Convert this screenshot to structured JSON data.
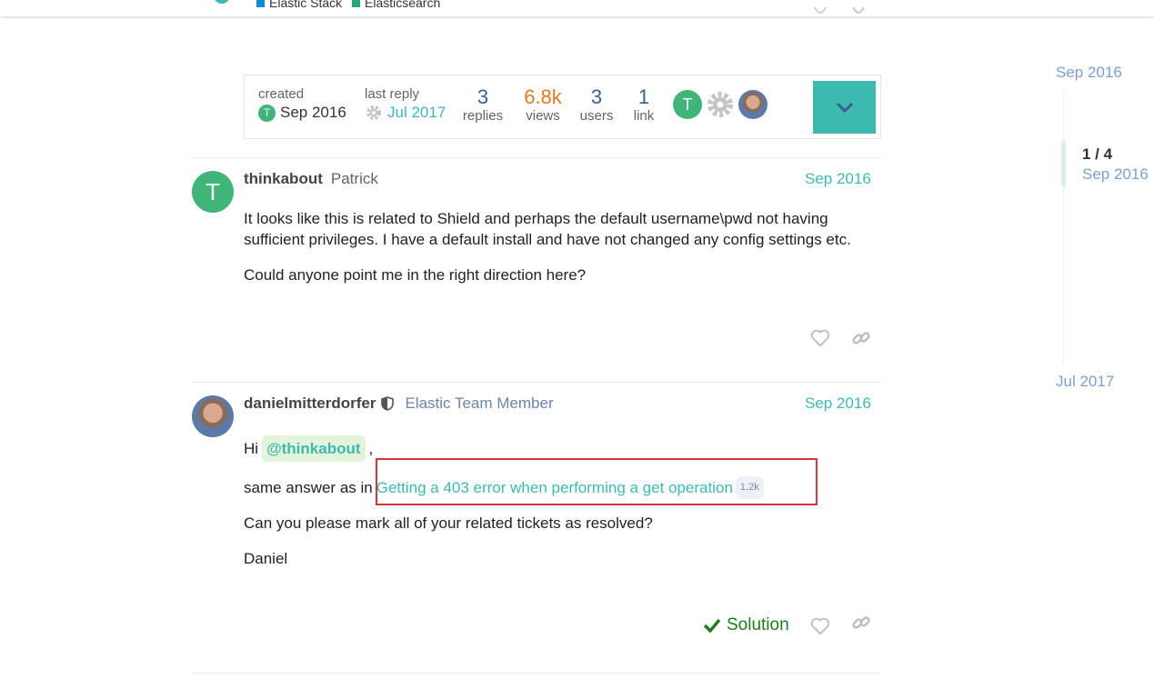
{
  "header": {
    "categories": [
      {
        "label": "Elastic Stack",
        "color": "#0a8bd6"
      },
      {
        "label": "Elasticsearch",
        "color": "#24a87a"
      }
    ]
  },
  "topic_map": {
    "created_label": "created",
    "created_value": "Sep 2016",
    "created_avatar_letter": "T",
    "last_reply_label": "last reply",
    "last_reply_value": "Jul 2017",
    "replies": {
      "value": "3",
      "label": "replies"
    },
    "views": {
      "value": "6.8k",
      "label": "views"
    },
    "users": {
      "value": "3",
      "label": "users"
    },
    "links": {
      "value": "1",
      "label": "link"
    },
    "participant_letter": "T",
    "expand_icon": "chevron-down-icon"
  },
  "posts": [
    {
      "username": "thinkabout",
      "full_name": "Patrick",
      "avatar_letter": "T",
      "date": "Sep 2016",
      "paragraphs": [
        "It looks like this is related to Shield and perhaps the default username\\pwd not having sufficient privileges. I have a default install and have not changed any config settings etc.",
        "Could anyone point me in the right direction here?"
      ]
    },
    {
      "username": "danielmitterdorfer",
      "title": "Elastic Team Member",
      "date": "Sep 2016",
      "greeting": "Hi",
      "mention": "@thinkabout",
      "after_mention": ",",
      "answer_prefix": "same answer as in",
      "link_text": "Getting a 403 error when performing a get operation",
      "link_clicks": "1.2k",
      "para3": "Can you please mark all of your related tickets as resolved?",
      "signature": "Daniel",
      "solution_label": "Solution"
    }
  ],
  "timeline": {
    "start_date": "Sep 2016",
    "position": "1 / 4",
    "position_date": "Sep 2016",
    "end_date": "Jul 2017"
  }
}
